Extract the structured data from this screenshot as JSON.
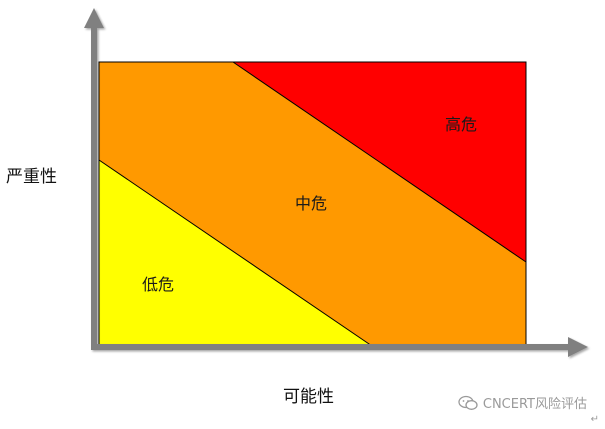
{
  "diagram": {
    "zones": {
      "high": "高危",
      "medium": "中危",
      "low": "低危"
    },
    "axes": {
      "y_label": "严重性",
      "x_label": "可能性"
    },
    "colors": {
      "high": "#ff0000",
      "medium": "#ff9900",
      "low": "#ffff00",
      "axis": "#7f7f7f",
      "border": "#000000"
    }
  },
  "watermark": {
    "text": "CNCERT风险评估",
    "icon": "wechat-icon"
  },
  "paragraph_mark": "↵"
}
